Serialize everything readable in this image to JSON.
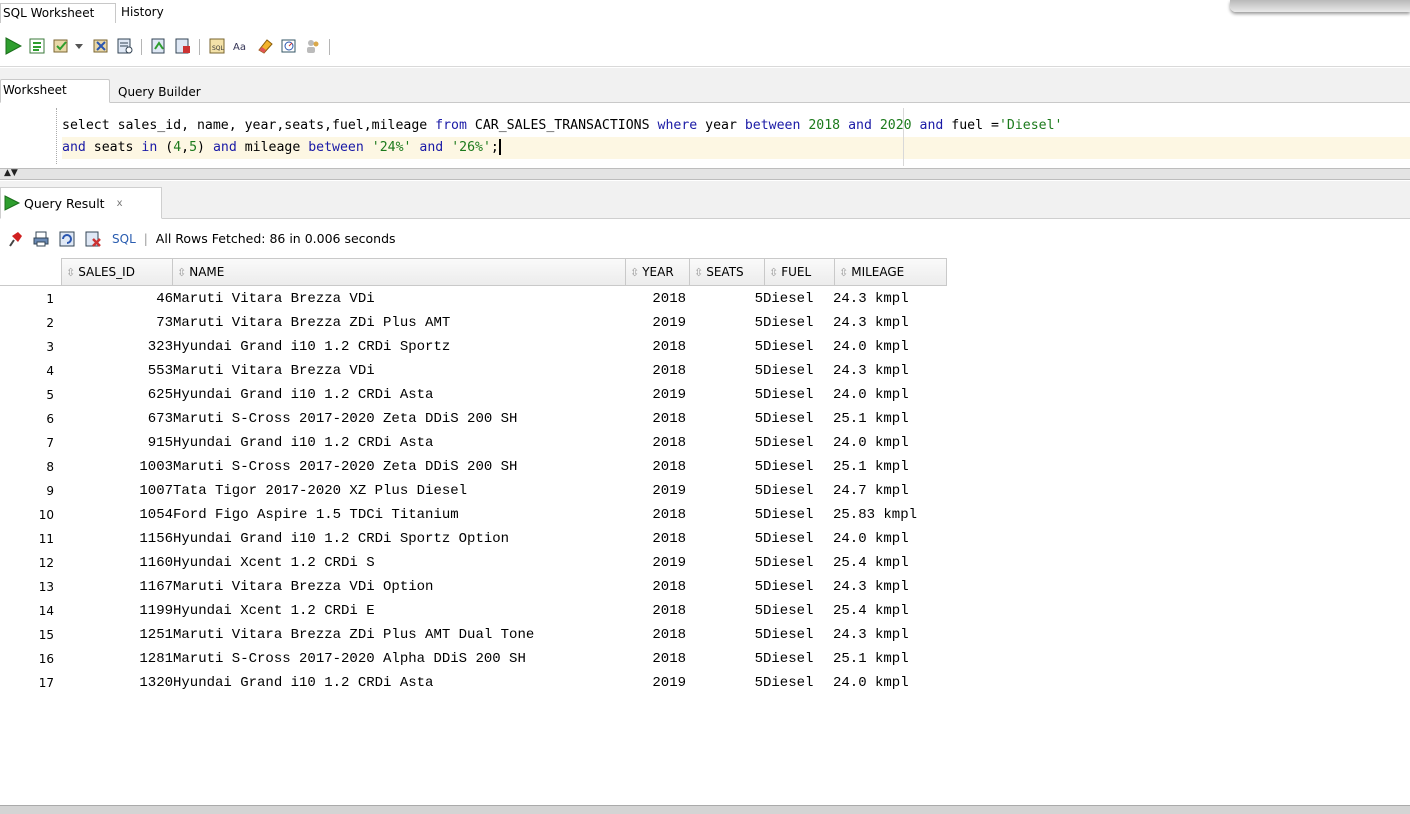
{
  "top_tabs": [
    "SQL Worksheet",
    "History"
  ],
  "worksheet_tabs": [
    "Worksheet",
    "Query Builder"
  ],
  "editor": {
    "line1": {
      "t1": "select sales_id, name, year,seats,fuel,mileage ",
      "k1": "from",
      "t2": " CAR_SALES_TRANSACTIONS ",
      "k2": "where",
      "t3": " year ",
      "k3": "between",
      "n1": " 2018 ",
      "k4": "and",
      "n2": " 2020 ",
      "k5": "and",
      "t4": " fuel =",
      "s1": "'Diesel'"
    },
    "line2": {
      "k1": "and",
      "t1": " seats ",
      "k2": "in",
      "t2": " (",
      "n1": "4",
      "t3": ",",
      "n2": "5",
      "t4": ") ",
      "k3": "and",
      "t5": " mileage ",
      "k4": "between",
      "t6": " ",
      "s1": "'24%'",
      "t7": " ",
      "k5": "and",
      "t8": " ",
      "s2": "'26%'",
      "t9": ";"
    }
  },
  "result_tab": {
    "label": "Query Result",
    "close": "x"
  },
  "result_toolbar": {
    "sql_label": "SQL",
    "separator": "|",
    "status": "All Rows Fetched: 86 in 0.006 seconds"
  },
  "columns": [
    "SALES_ID",
    "NAME",
    "YEAR",
    "SEATS",
    "FUEL",
    "MILEAGE"
  ],
  "rows": [
    {
      "n": "1",
      "id": "46",
      "name": "Maruti Vitara Brezza VDi",
      "year": "2018",
      "seats": "5",
      "fuel": "Diesel",
      "mileage": "24.3 kmpl"
    },
    {
      "n": "2",
      "id": "73",
      "name": "Maruti Vitara Brezza ZDi Plus AMT",
      "year": "2019",
      "seats": "5",
      "fuel": "Diesel",
      "mileage": "24.3 kmpl"
    },
    {
      "n": "3",
      "id": "323",
      "name": "Hyundai Grand i10 1.2 CRDi Sportz",
      "year": "2018",
      "seats": "5",
      "fuel": "Diesel",
      "mileage": "24.0 kmpl"
    },
    {
      "n": "4",
      "id": "553",
      "name": "Maruti Vitara Brezza VDi",
      "year": "2018",
      "seats": "5",
      "fuel": "Diesel",
      "mileage": "24.3 kmpl"
    },
    {
      "n": "5",
      "id": "625",
      "name": "Hyundai Grand i10 1.2 CRDi Asta",
      "year": "2019",
      "seats": "5",
      "fuel": "Diesel",
      "mileage": "24.0 kmpl"
    },
    {
      "n": "6",
      "id": "673",
      "name": "Maruti S-Cross 2017-2020 Zeta DDiS 200 SH",
      "year": "2018",
      "seats": "5",
      "fuel": "Diesel",
      "mileage": "25.1 kmpl"
    },
    {
      "n": "7",
      "id": "915",
      "name": "Hyundai Grand i10 1.2 CRDi Asta",
      "year": "2018",
      "seats": "5",
      "fuel": "Diesel",
      "mileage": "24.0 kmpl"
    },
    {
      "n": "8",
      "id": "1003",
      "name": "Maruti S-Cross 2017-2020 Zeta DDiS 200 SH",
      "year": "2018",
      "seats": "5",
      "fuel": "Diesel",
      "mileage": "25.1 kmpl"
    },
    {
      "n": "9",
      "id": "1007",
      "name": "Tata Tigor 2017-2020 XZ Plus Diesel",
      "year": "2019",
      "seats": "5",
      "fuel": "Diesel",
      "mileage": "24.7 kmpl"
    },
    {
      "n": "10",
      "id": "1054",
      "name": "Ford Figo Aspire 1.5 TDCi Titanium",
      "year": "2018",
      "seats": "5",
      "fuel": "Diesel",
      "mileage": "25.83 kmpl"
    },
    {
      "n": "11",
      "id": "1156",
      "name": "Hyundai Grand i10 1.2 CRDi Sportz Option",
      "year": "2018",
      "seats": "5",
      "fuel": "Diesel",
      "mileage": "24.0 kmpl"
    },
    {
      "n": "12",
      "id": "1160",
      "name": "Hyundai Xcent 1.2 CRDi S",
      "year": "2019",
      "seats": "5",
      "fuel": "Diesel",
      "mileage": "25.4 kmpl"
    },
    {
      "n": "13",
      "id": "1167",
      "name": "Maruti Vitara Brezza VDi Option",
      "year": "2018",
      "seats": "5",
      "fuel": "Diesel",
      "mileage": "24.3 kmpl"
    },
    {
      "n": "14",
      "id": "1199",
      "name": "Hyundai Xcent 1.2 CRDi E",
      "year": "2018",
      "seats": "5",
      "fuel": "Diesel",
      "mileage": "25.4 kmpl"
    },
    {
      "n": "15",
      "id": "1251",
      "name": "Maruti Vitara Brezza ZDi Plus AMT Dual Tone",
      "year": "2018",
      "seats": "5",
      "fuel": "Diesel",
      "mileage": "24.3 kmpl"
    },
    {
      "n": "16",
      "id": "1281",
      "name": "Maruti S-Cross 2017-2020 Alpha DDiS 200 SH",
      "year": "2018",
      "seats": "5",
      "fuel": "Diesel",
      "mileage": "25.1 kmpl"
    },
    {
      "n": "17",
      "id": "1320",
      "name": "Hyundai Grand i10 1.2 CRDi Asta",
      "year": "2019",
      "seats": "5",
      "fuel": "Diesel",
      "mileage": "24.0 kmpl"
    }
  ],
  "colors": {
    "keyword": "#1a1aa6",
    "string": "#1c7a1c",
    "run_green": "#2e9e2e",
    "pin_red": "#d02020",
    "sql_link": "#2a5db0"
  }
}
